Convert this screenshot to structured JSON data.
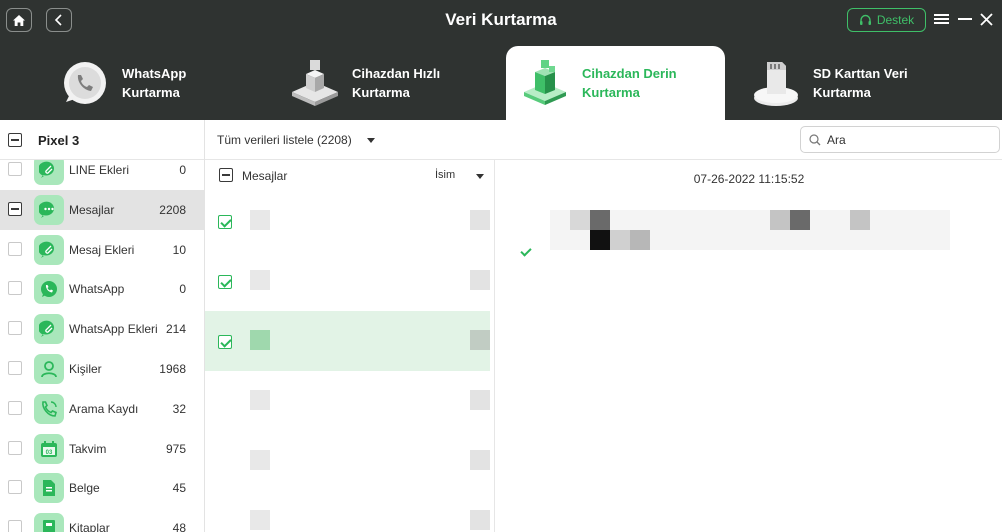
{
  "app": {
    "title": "Veri Kurtarma",
    "support_label": "Destek",
    "icons": {
      "home": "home-icon",
      "back": "back-arrow-icon",
      "support": "headset-icon",
      "menu": "menu-icon",
      "minimize": "minimize-icon",
      "close": "close-icon"
    }
  },
  "tabs": [
    {
      "label": "WhatsApp\nKurtarma",
      "icon": "whatsapp-phone-icon",
      "active": false
    },
    {
      "label": "Cihazdan Hızlı\nKurtarma",
      "icon": "device-quick-icon",
      "active": false
    },
    {
      "label": "Cihazdan Derin\nKurtarma",
      "icon": "device-deep-icon",
      "active": true
    },
    {
      "label": "SD Karttan Veri\nKurtarma",
      "icon": "sd-card-icon",
      "active": false
    }
  ],
  "device": {
    "name": "Pixel 3"
  },
  "categories": [
    {
      "label": "LINE Ekleri",
      "count": "0",
      "icon": "attachment-bubble-icon",
      "selected": false
    },
    {
      "label": "Mesajlar",
      "count": "2208",
      "icon": "message-bubble-icon",
      "selected": true
    },
    {
      "label": "Mesaj Ekleri",
      "count": "10",
      "icon": "attachment-bubble-icon",
      "selected": false
    },
    {
      "label": "WhatsApp",
      "count": "0",
      "icon": "whatsapp-icon",
      "selected": false
    },
    {
      "label": "WhatsApp Ekleri",
      "count": "214",
      "icon": "attachment-bubble-icon",
      "selected": false
    },
    {
      "label": "Kişiler",
      "count": "1968",
      "icon": "contact-icon",
      "selected": false
    },
    {
      "label": "Arama Kaydı",
      "count": "32",
      "icon": "phone-call-icon",
      "selected": false
    },
    {
      "label": "Takvim",
      "count": "975",
      "icon": "calendar-icon",
      "selected": false
    },
    {
      "label": "Belge",
      "count": "45",
      "icon": "document-icon",
      "selected": false
    },
    {
      "label": "Kitaplar",
      "count": "48",
      "icon": "book-icon",
      "selected": false
    }
  ],
  "filter": {
    "selected": "Tüm verileri listele (2208)"
  },
  "search": {
    "placeholder": "Ara"
  },
  "list": {
    "header": "Mesajlar",
    "sort_label": "İsim"
  },
  "messages": [
    {
      "checked": true,
      "selected": false
    },
    {
      "checked": true,
      "selected": false
    },
    {
      "checked": true,
      "selected": true
    },
    {
      "checked": false,
      "selected": false
    },
    {
      "checked": false,
      "selected": false
    },
    {
      "checked": false,
      "selected": false
    }
  ],
  "detail": {
    "timestamp": "07-26-2022 11:15:52"
  },
  "colors": {
    "header_bg": "#2f3331",
    "accent": "#2bb75a",
    "selected_row": "#e2f3e6",
    "icon_bg": "#a9e7bb"
  }
}
